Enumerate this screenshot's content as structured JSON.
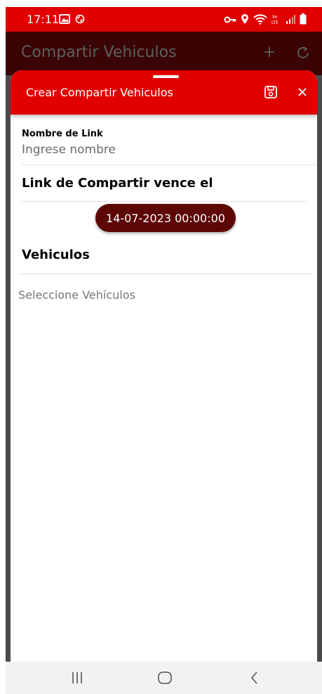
{
  "status_bar": {
    "time": "17:11",
    "icons_left": [
      "gallery-icon",
      "sync-icon"
    ],
    "icons_right": [
      "vpn-key-icon",
      "location-icon",
      "wifi-icon",
      "volte-lte-icon",
      "signal-icon",
      "battery-icon"
    ],
    "bar_color": "#e00000"
  },
  "app_bar": {
    "title": "Compartir Vehiculos",
    "actions": [
      "add-icon",
      "refresh-icon"
    ],
    "bg_color": "#3a0404"
  },
  "sheet": {
    "title": "Crear Compartir Vehiculos",
    "header_color": "#e00000",
    "actions": [
      "save-icon",
      "close-icon"
    ],
    "name_field": {
      "label": "Nombre de Link",
      "placeholder": "Ingrese nombre",
      "value": ""
    },
    "expiry": {
      "label": "Link de Compartir vence el",
      "value": "14-07-2023 00:00:00",
      "chip_color": "#5c0606"
    },
    "vehicles": {
      "label": "Vehiculos",
      "placeholder": "Seleccione Vehículos"
    }
  },
  "nav_bar": {
    "buttons": [
      "recents-icon",
      "home-icon",
      "back-icon"
    ]
  }
}
